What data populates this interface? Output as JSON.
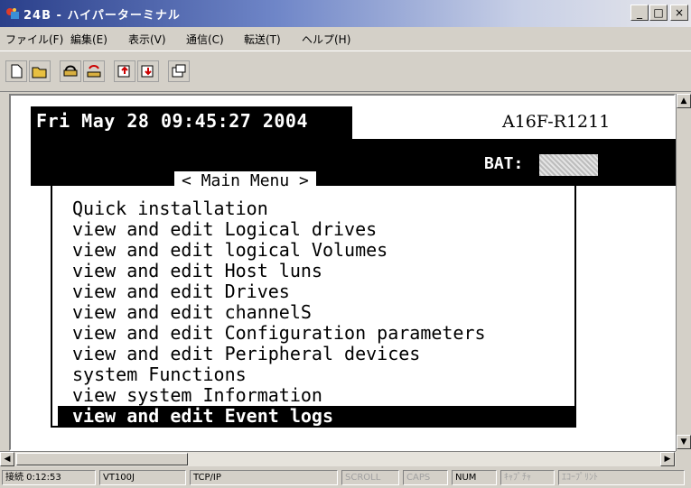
{
  "window": {
    "title": "24B - ハイパーターミナル",
    "min_label": "_",
    "max_label": "□",
    "close_label": "×"
  },
  "menu": [
    {
      "label": "ファイル(F)"
    },
    {
      "label": "編集(E)"
    },
    {
      "label": "表示(V)"
    },
    {
      "label": "通信(C)"
    },
    {
      "label": "転送(T)"
    },
    {
      "label": "ヘルプ(H)"
    }
  ],
  "toolbar": {
    "icons": [
      "new-icon",
      "open-icon",
      "connect-icon",
      "disconnect-icon",
      "send-icon",
      "receive-icon",
      "properties-icon"
    ]
  },
  "terminal": {
    "datetime": "Fri May 28 09:45:27 2004",
    "model": "A16F-R1211",
    "bat_label": "BAT:",
    "main_menu_title": "< Main Menu >",
    "items": [
      "Quick installation",
      "view and edit Logical drives",
      "view and edit logical Volumes",
      "view and edit Host luns",
      "view and edit Drives",
      "view and edit channelS",
      "view and edit Configuration parameters",
      "view and edit Peripheral devices",
      "system Functions",
      "view system Information",
      "view and edit Event logs"
    ],
    "selected_index": 10
  },
  "status": {
    "connect_time": "接続 0:12:53",
    "emulation": "VT100J",
    "protocol": "TCP/IP",
    "scroll": "SCROLL",
    "caps": "CAPS",
    "num": "NUM",
    "capture": "ｷｬﾌﾟﾁｬ",
    "echo": "ｴｺｰﾌﾟﾘﾝﾄ"
  },
  "colors": {
    "terminal_bg": "#ffffff",
    "terminal_fg": "#000000",
    "chrome": "#d4d0c8",
    "title_gradient_start": "#2a3f8a"
  }
}
